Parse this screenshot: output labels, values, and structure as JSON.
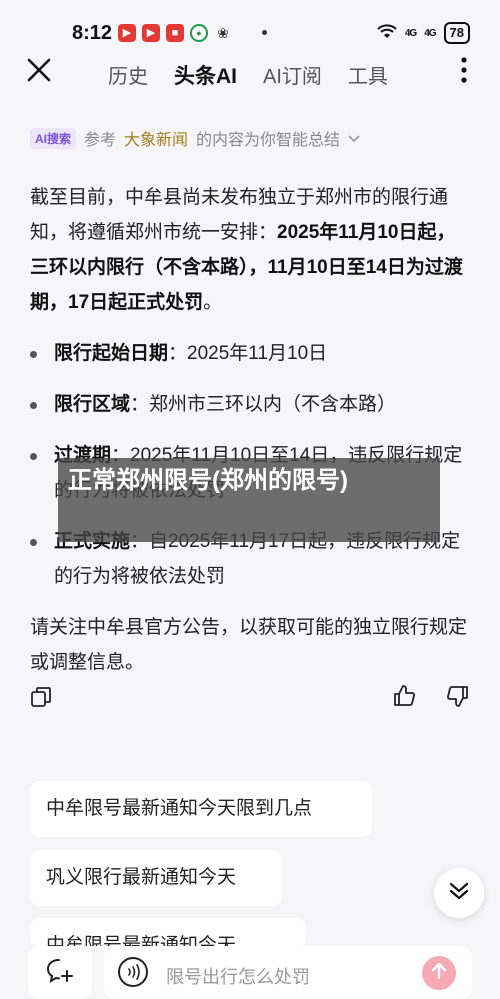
{
  "status_bar": {
    "time": "8:12",
    "app_icons": [
      "notif-app-1",
      "notif-app-2",
      "notif-app-3",
      "notif-app-4",
      "notif-app-5"
    ],
    "network_1": "4G",
    "network_2": "4G",
    "battery": "78"
  },
  "nav": {
    "tabs": [
      {
        "label": "历史"
      },
      {
        "label": "头条AI"
      },
      {
        "label": "AI订阅"
      },
      {
        "label": "工具"
      }
    ],
    "active_tab": "头条AI"
  },
  "source": {
    "badge": "AI搜索",
    "prefix": "参考",
    "name": "大象新闻",
    "suffix": "的内容为你智能总结"
  },
  "answer": {
    "intro_plain": "截至目前，中牟县尚未发布独立于郑州市的限行通知，将遵循郑州市统一安排：",
    "intro_bold": "2025年11月10日起，三环以内限行（不含本路），11月10日至14日为过渡期，17日起正式处罚",
    "intro_end": "。",
    "bullets": [
      {
        "label": "限行起始日期",
        "text": "：2025年11月10日"
      },
      {
        "label": "限行区域",
        "text": "：郑州市三环以内（不含本路）"
      },
      {
        "label": "过渡期",
        "text": "：2025年11月10日至14日，违反限行规定的行为将被依法处罚"
      },
      {
        "label": "正式实施",
        "text": "：自2025年11月17日起，违反限行规定的行为将被依法处罚"
      }
    ],
    "closing": "请关注中牟县官方公告，以获取可能的独立限行规定或调整信息。"
  },
  "overlay": {
    "text": "正常郑州限号(郑州的限号)"
  },
  "suggestions": [
    {
      "text": "中牟限号最新通知今天限到几点"
    },
    {
      "text": "巩义限行最新通知今天"
    },
    {
      "text": "中牟限号最新通知今天"
    }
  ],
  "input": {
    "placeholder": "限号出行怎么处罚"
  },
  "colors": {
    "accent_purple": "#7b52d9",
    "source_gold": "#a67c1e",
    "send_pink": "#f7aab4"
  }
}
